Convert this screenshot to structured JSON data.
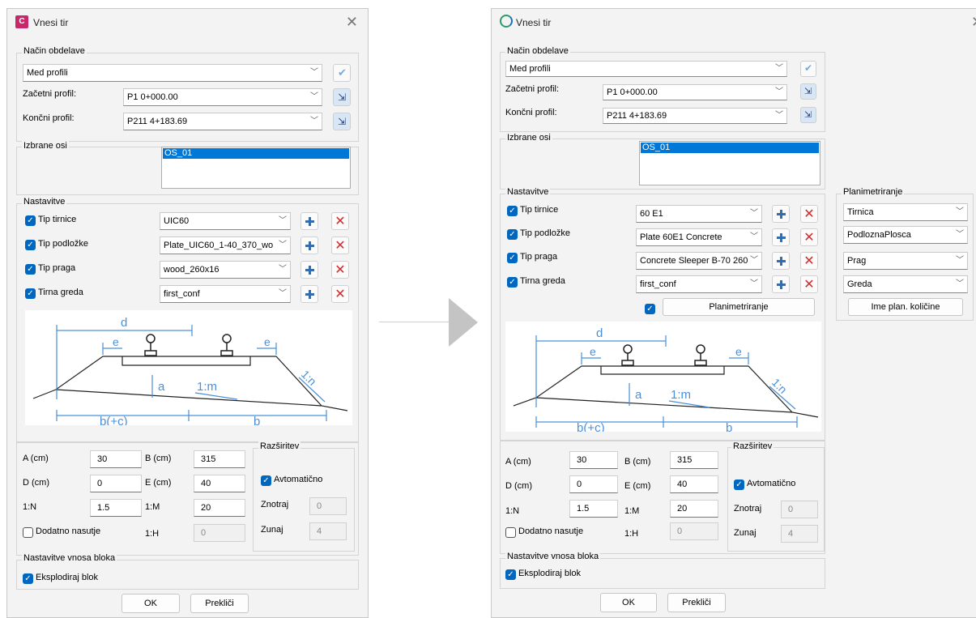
{
  "left": {
    "title": "Vnesi tir",
    "nacin": {
      "legend": "Način obdelave",
      "mode": "Med profili",
      "start_label": "Začetni profil:",
      "start_value": "P1 0+000.00",
      "end_label": "Končni profil:",
      "end_value": "P211 4+183.69"
    },
    "osi": {
      "legend": "Izbrane osi",
      "item": "OS_01"
    },
    "nastavitve": {
      "legend": "Nastavitve",
      "rows": [
        {
          "label": "Tip tirnice",
          "value": "UIC60"
        },
        {
          "label": "Tip podložke",
          "value": "Plate_UIC60_1-40_370_wo"
        },
        {
          "label": "Tip praga",
          "value": "wood_260x16"
        },
        {
          "label": "Tirna greda",
          "value": "first_conf"
        }
      ]
    },
    "params": {
      "a_label": "A (cm)",
      "a": "30",
      "b_label": "B (cm)",
      "b": "315",
      "d_label": "D (cm)",
      "d": "0",
      "e_label": "E (cm)",
      "e": "40",
      "n_label": "1:N",
      "n": "1.5",
      "m_label": "1:M",
      "m": "20",
      "extra_label": "Dodatno nasutje",
      "h_label": "1:H",
      "h": "0"
    },
    "razsiritev": {
      "legend": "Razširitev",
      "auto_label": "Avtomatično",
      "in_label": "Znotraj",
      "in_value": "0",
      "out_label": "Zunaj",
      "out_value": "4"
    },
    "blok": {
      "legend": "Nastavitve vnosa bloka",
      "explode_label": "Eksplodiraj blok"
    },
    "ok": "OK",
    "cancel": "Prekliči"
  },
  "right": {
    "title": "Vnesi tir",
    "nacin": {
      "legend": "Način obdelave",
      "mode": "Med profili",
      "start_label": "Začetni profil:",
      "start_value": "P1 0+000.00",
      "end_label": "Končni profil:",
      "end_value": "P211 4+183.69"
    },
    "osi": {
      "legend": "Izbrane osi",
      "item": "OS_01"
    },
    "nastavitve": {
      "legend": "Nastavitve",
      "rows": [
        {
          "label": "Tip tirnice",
          "value": "60 E1"
        },
        {
          "label": "Tip podložke",
          "value": "Plate 60E1 Concrete"
        },
        {
          "label": "Tip praga",
          "value": "Concrete Sleeper B-70 260"
        },
        {
          "label": "Tirna greda",
          "value": "first_conf"
        }
      ],
      "plan_button": "Planimetriranje"
    },
    "planim": {
      "legend": "Planimetriranje",
      "items": [
        "Tirnica",
        "PodloznaPlosca",
        "Prag",
        "Greda"
      ],
      "button": "Ime plan. količine"
    },
    "params": {
      "a_label": "A (cm)",
      "a": "30",
      "b_label": "B (cm)",
      "b": "315",
      "d_label": "D (cm)",
      "d": "0",
      "e_label": "E (cm)",
      "e": "40",
      "n_label": "1:N",
      "n": "1.5",
      "m_label": "1:M",
      "m": "20",
      "extra_label": "Dodatno nasutje",
      "h_label": "1:H",
      "h": "0"
    },
    "razsiritev": {
      "legend": "Razširitev",
      "auto_label": "Avtomatično",
      "in_label": "Znotraj",
      "in_value": "0",
      "out_label": "Zunaj",
      "out_value": "4"
    },
    "blok": {
      "legend": "Nastavitve vnosa bloka",
      "explode_label": "Eksplodiraj blok"
    },
    "ok": "OK",
    "cancel": "Prekliči"
  },
  "diagram": {
    "d": "d",
    "e": "e",
    "a": "a",
    "m": "1:m",
    "n": "1:n",
    "bc": "b(+c)",
    "b": "b"
  },
  "colors": {
    "accent": "#0078d7",
    "check": "#0067c0",
    "delete": "#d42a2a",
    "diagram": "#4a90d9"
  }
}
